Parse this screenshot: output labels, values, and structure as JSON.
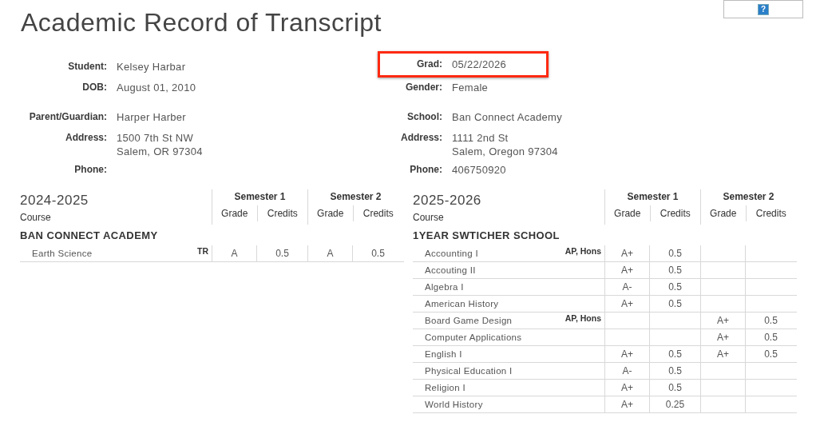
{
  "title": "Academic Record of Transcript",
  "help_button": {
    "label": "?"
  },
  "student_info": [
    [
      {
        "label": "Student:",
        "value": [
          "Kelsey Harbar"
        ]
      },
      {
        "label": "DOB:",
        "value": [
          "August 01, 2010"
        ]
      }
    ],
    [
      {
        "label": "Parent/Guardian:",
        "value": [
          "Harper Harber"
        ]
      },
      {
        "label": "Address:",
        "value": [
          "1500 7th St NW",
          "Salem, OR 97304"
        ]
      },
      {
        "label": "Phone:"
      }
    ]
  ],
  "school_info": [
    [
      {
        "label": "Grad:",
        "value": [
          "05/22/2026"
        ],
        "highlighted": true
      },
      {
        "label": "Gender:",
        "value": [
          "Female"
        ]
      }
    ],
    [
      {
        "label": "School:",
        "value": [
          "Ban Connect Academy"
        ]
      },
      {
        "label": "Address:",
        "value": [
          "1111 2nd St",
          "Salem, Oregon 97304"
        ]
      },
      {
        "label": "Phone:",
        "value": [
          "406750920"
        ]
      }
    ]
  ],
  "years": [
    {
      "year": "2024-2025",
      "course_label": "Course",
      "semesters": [
        {
          "label": "Semester 1",
          "columns": [
            "Grade",
            "Credits"
          ]
        },
        {
          "label": "Semester 2",
          "columns": [
            "Grade",
            "Credits"
          ]
        }
      ],
      "school": "BAN CONNECT ACADEMY",
      "rows": [
        {
          "course": "Earth Science",
          "tags": "TR",
          "s1": [
            "A",
            "0.5"
          ],
          "s2": [
            "A",
            "0.5"
          ]
        }
      ]
    },
    {
      "year": "2025-2026",
      "course_label": "Course",
      "semesters": [
        {
          "label": "Semester 1",
          "columns": [
            "Grade",
            "Credits"
          ]
        },
        {
          "label": "Semester 2",
          "columns": [
            "Grade",
            "Credits"
          ]
        }
      ],
      "school": "1YEAR SWTICHER SCHOOL",
      "rows": [
        {
          "course": "Accounting I",
          "tags": "AP, Hons",
          "s1": [
            "A+",
            "0.5"
          ]
        },
        {
          "course": "Accouting II",
          "s1": [
            "A+",
            "0.5"
          ]
        },
        {
          "course": "Algebra I",
          "s1": [
            "A-",
            "0.5"
          ]
        },
        {
          "course": "American History",
          "s1": [
            "A+",
            "0.5"
          ]
        },
        {
          "course": "Board Game Design",
          "tags": "AP, Hons",
          "s2": [
            "A+",
            "0.5"
          ]
        },
        {
          "course": "Computer Applications",
          "s2": [
            "A+",
            "0.5"
          ]
        },
        {
          "course": "English I",
          "s1": [
            "A+",
            "0.5"
          ],
          "s2": [
            "A+",
            "0.5"
          ]
        },
        {
          "course": "Physical Education I",
          "s1": [
            "A-",
            "0.5"
          ]
        },
        {
          "course": "Religion I",
          "s1": [
            "A+",
            "0.5"
          ]
        },
        {
          "course": "World History",
          "s1": [
            "A+",
            "0.25"
          ]
        }
      ]
    }
  ]
}
